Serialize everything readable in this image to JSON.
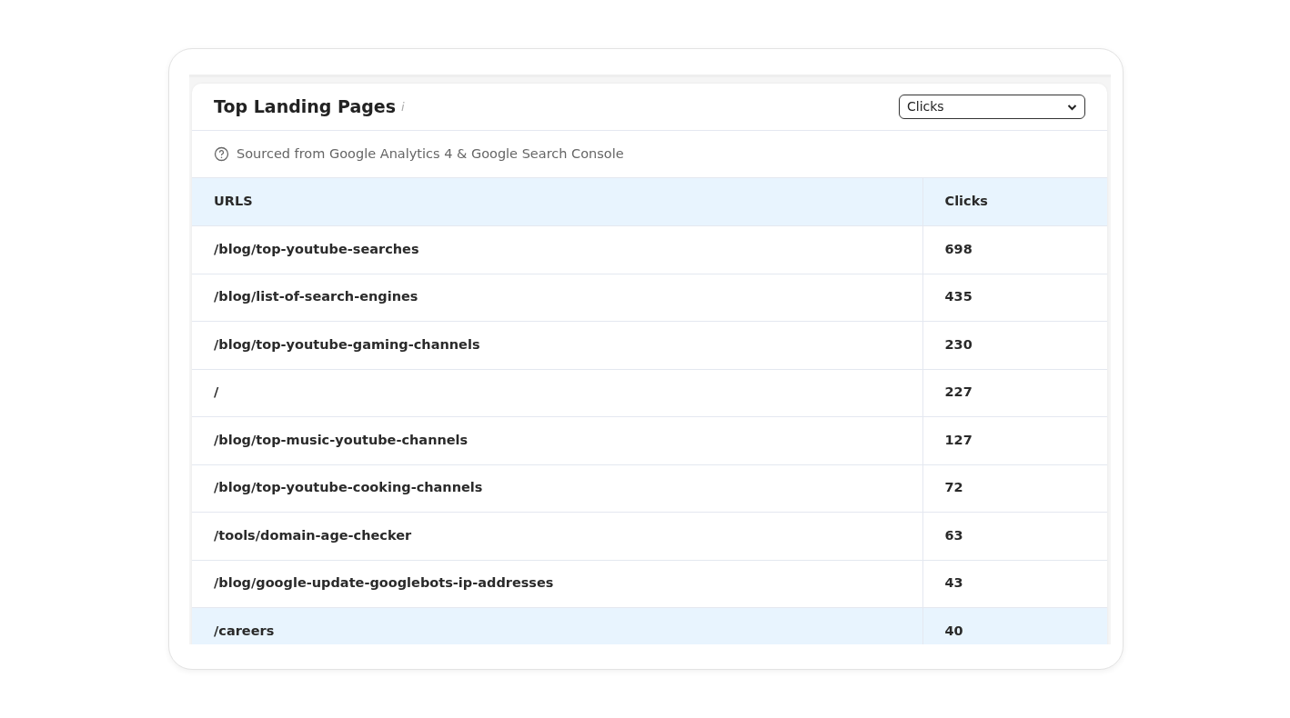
{
  "widget": {
    "title": "Top Landing Pages",
    "info_mark": "i",
    "metric_select": {
      "value": "Clicks"
    },
    "source_note": "Sourced from Google Analytics 4 & Google Search Console"
  },
  "table": {
    "columns": [
      "URLS",
      "Clicks"
    ],
    "rows": [
      {
        "url": "/blog/top-youtube-searches",
        "clicks": "698",
        "highlighted": false
      },
      {
        "url": "/blog/list-of-search-engines",
        "clicks": "435",
        "highlighted": false
      },
      {
        "url": "/blog/top-youtube-gaming-channels",
        "clicks": "230",
        "highlighted": false
      },
      {
        "url": "/",
        "clicks": "227",
        "highlighted": false
      },
      {
        "url": "/blog/top-music-youtube-channels",
        "clicks": "127",
        "highlighted": false
      },
      {
        "url": "/blog/top-youtube-cooking-channels",
        "clicks": "72",
        "highlighted": false
      },
      {
        "url": "/tools/domain-age-checker",
        "clicks": "63",
        "highlighted": false
      },
      {
        "url": "/blog/google-update-googlebots-ip-addresses",
        "clicks": "43",
        "highlighted": false
      },
      {
        "url": "/careers",
        "clicks": "40",
        "highlighted": true
      }
    ]
  }
}
